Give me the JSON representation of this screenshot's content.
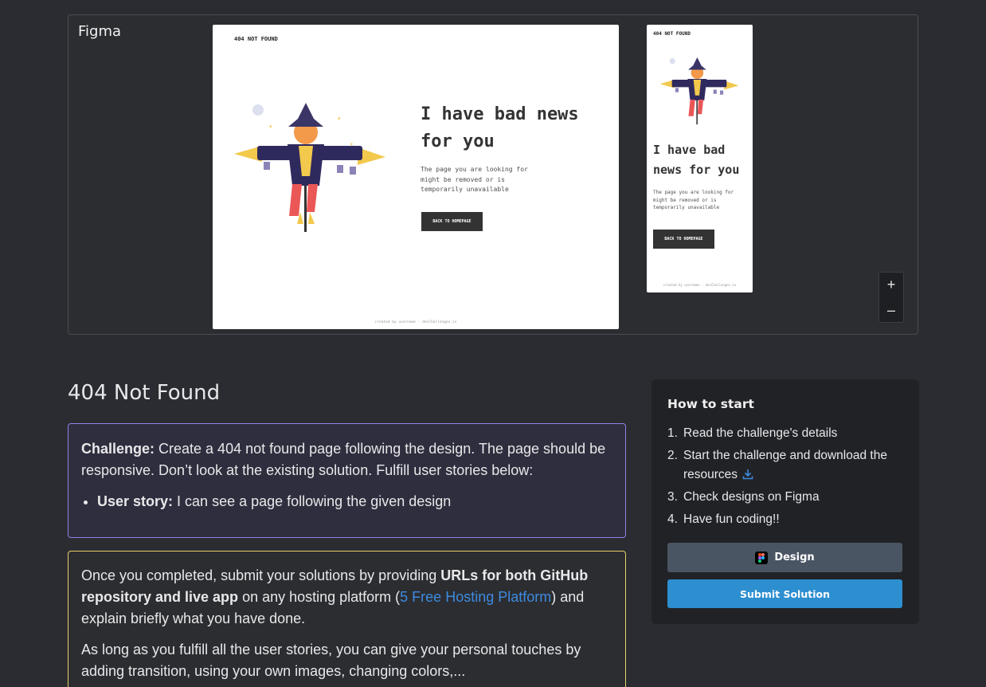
{
  "preview": {
    "logo": "Figma",
    "zoom_in": "+",
    "zoom_out": "–",
    "desktop": {
      "brand": "404 NOT FOUND",
      "heading": "I have bad news for you",
      "text": "The page you are looking for might be removed or is temporarily unavailable",
      "button": "BACK TO HOMEPAGE",
      "footer": "created by username - devChallenges.io"
    },
    "mobile": {
      "brand": "404 NOT FOUND",
      "heading": "I have bad news for you",
      "text": "The page you are looking for might be removed or is temporarily unavailable",
      "button": "BACK TO HOMEPAGE",
      "footer": "created by username - devChallenges.io"
    }
  },
  "main": {
    "title": "404 Not Found",
    "challenge": {
      "label": "Challenge:",
      "text": " Create a 404 not found page following the design. The page should be responsive. Don’t look at the existing solution. Fulfill user stories below:",
      "story_label": "User story:",
      "story_text": " I can see a page following the given design"
    },
    "submit": {
      "p1_before": "Once you completed, submit your solutions by providing ",
      "p1_bold": "URLs for both GitHub repository and live app",
      "p1_mid": " on any hosting platform (",
      "p1_link": "5 Free Hosting Platform",
      "p1_after": ") and explain briefly what you have done.",
      "p2": "As long as you fulfill all the user stories, you can give your personal touches by adding transition, using your own images, changing colors,..."
    }
  },
  "sidebar": {
    "title": "How to start",
    "steps": [
      {
        "num": "1.",
        "text": "Read the challenge's details"
      },
      {
        "num": "2.",
        "text": "Start the challenge and download the resources"
      },
      {
        "num": "3.",
        "text": "Check designs on Figma"
      },
      {
        "num": "4.",
        "text": "Have fun coding!!"
      }
    ],
    "design_button": "Design",
    "submit_button": "Submit Solution"
  },
  "colors": {
    "accent_purple": "#8d83e6",
    "accent_yellow": "#e8d06a",
    "link_blue": "#3d8be0",
    "submit_blue": "#2d8fd0"
  }
}
